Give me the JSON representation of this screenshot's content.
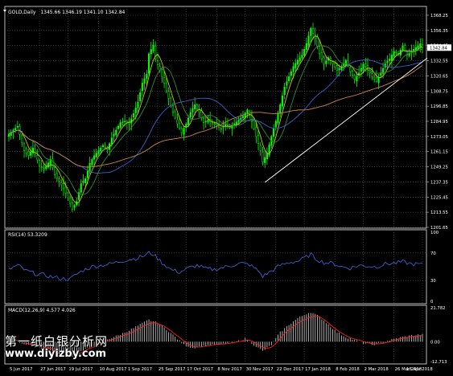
{
  "header": {
    "symbol": "GOLD,Daily",
    "values": "1345.66 1346.19 1341.10 1342.84"
  },
  "colors": {
    "bull": "#00ff00",
    "bear": "#000000",
    "grid": "#5a5a5a",
    "ma_fast": "#c8c800",
    "ma_mid": "#2e8b2e",
    "ma_slow": "#3a5fd0",
    "ma_long": "#cd853f",
    "trendline": "#ffffff",
    "rsi": "#4169e1",
    "macd_hist": "#c0c0c0",
    "macd_signal": "#ff2020",
    "price_box_bg": "#ffffff",
    "price_box_fg": "#000000"
  },
  "chart_data": [
    {
      "type": "candlestick",
      "title": "GOLD,Daily",
      "price_axis_ticks": [
        "1368.25",
        "1356.35",
        "1344.45",
        "1332.55",
        "1320.65",
        "1308.75",
        "1296.85",
        "1284.95",
        "1273.05",
        "1261.15",
        "1249.25",
        "1237.35",
        "1225.45",
        "1213.55",
        "1201.65"
      ],
      "ylim": [
        1201.65,
        1368.25
      ],
      "current_price": "1342.84",
      "date_ticks": [
        "5 Jun 2017",
        "27 Jun 2017",
        "19 Jul 2017",
        "10 Aug 2017",
        "1 Sep 2017",
        "25 Sep 2017",
        "17 Oct 2017",
        "8 Nov 2017",
        "30 Nov 2017",
        "22 Dec 2017",
        "17 Jan 2018",
        "8 Feb 2018",
        "2 Mar 2018",
        "26 Mar 2018",
        "18 Apr 2018"
      ],
      "close_anchors": [
        [
          0,
          1275
        ],
        [
          4,
          1281
        ],
        [
          7,
          1262
        ],
        [
          9,
          1258
        ],
        [
          11,
          1264
        ],
        [
          14,
          1250
        ],
        [
          16,
          1247
        ],
        [
          19,
          1255
        ],
        [
          21,
          1243
        ],
        [
          23,
          1238
        ],
        [
          25,
          1232
        ],
        [
          27,
          1225
        ],
        [
          29,
          1216
        ],
        [
          31,
          1222
        ],
        [
          33,
          1236
        ],
        [
          35,
          1240
        ],
        [
          37,
          1252
        ],
        [
          39,
          1258
        ],
        [
          41,
          1262
        ],
        [
          43,
          1266
        ],
        [
          45,
          1263
        ],
        [
          47,
          1272
        ],
        [
          49,
          1278
        ],
        [
          51,
          1284
        ],
        [
          53,
          1285
        ],
        [
          55,
          1283
        ],
        [
          57,
          1291
        ],
        [
          59,
          1300
        ],
        [
          61,
          1315
        ],
        [
          63,
          1322
        ],
        [
          64,
          1338
        ],
        [
          66,
          1345
        ],
        [
          67,
          1334
        ],
        [
          69,
          1325
        ],
        [
          71,
          1315
        ],
        [
          73,
          1303
        ],
        [
          75,
          1292
        ],
        [
          77,
          1283
        ],
        [
          79,
          1276
        ],
        [
          81,
          1283
        ],
        [
          83,
          1292
        ],
        [
          85,
          1298
        ],
        [
          87,
          1292
        ],
        [
          89,
          1284
        ],
        [
          91,
          1286
        ],
        [
          93,
          1283
        ],
        [
          95,
          1282
        ],
        [
          97,
          1279
        ],
        [
          99,
          1283
        ],
        [
          101,
          1280
        ],
        [
          103,
          1283
        ],
        [
          105,
          1286
        ],
        [
          107,
          1289
        ],
        [
          109,
          1294
        ],
        [
          111,
          1285
        ],
        [
          113,
          1273
        ],
        [
          115,
          1262
        ],
        [
          116,
          1253
        ],
        [
          118,
          1260
        ],
        [
          120,
          1273
        ],
        [
          122,
          1285
        ],
        [
          124,
          1298
        ],
        [
          126,
          1312
        ],
        [
          128,
          1320
        ],
        [
          130,
          1328
        ],
        [
          132,
          1333
        ],
        [
          134,
          1337
        ],
        [
          136,
          1346
        ],
        [
          138,
          1358
        ],
        [
          140,
          1350
        ],
        [
          142,
          1338
        ],
        [
          144,
          1330
        ],
        [
          146,
          1335
        ],
        [
          148,
          1330
        ],
        [
          150,
          1325
        ],
        [
          152,
          1328
        ],
        [
          154,
          1333
        ],
        [
          156,
          1324
        ],
        [
          158,
          1318
        ],
        [
          160,
          1323
        ],
        [
          162,
          1330
        ],
        [
          164,
          1326
        ],
        [
          166,
          1320
        ],
        [
          168,
          1316
        ],
        [
          170,
          1323
        ],
        [
          172,
          1330
        ],
        [
          174,
          1334
        ],
        [
          176,
          1340
        ],
        [
          178,
          1338
        ],
        [
          180,
          1344
        ],
        [
          182,
          1337
        ],
        [
          184,
          1340
        ],
        [
          186,
          1343
        ],
        [
          188,
          1346
        ],
        [
          189,
          1342.84
        ]
      ],
      "moving_averages": [
        {
          "period": "fast",
          "smoothing": 5
        },
        {
          "period": "mid",
          "smoothing": 11
        },
        {
          "period": "slow",
          "smoothing": 34
        },
        {
          "period": "long",
          "smoothing": 70
        }
      ],
      "trendline": {
        "from": [
          117,
          1237
        ],
        "to": [
          189,
          1334
        ]
      }
    },
    {
      "type": "line",
      "title": "RSI(14) 53.3209",
      "ticks": [
        "100",
        "70",
        "30",
        "0"
      ],
      "ylim": [
        0,
        100
      ],
      "levels": [
        70,
        30
      ],
      "anchors": [
        [
          0,
          46
        ],
        [
          4,
          52
        ],
        [
          8,
          44
        ],
        [
          12,
          40
        ],
        [
          16,
          38
        ],
        [
          20,
          35
        ],
        [
          24,
          33
        ],
        [
          28,
          32
        ],
        [
          30,
          37
        ],
        [
          34,
          45
        ],
        [
          38,
          50
        ],
        [
          42,
          52
        ],
        [
          46,
          54
        ],
        [
          50,
          57
        ],
        [
          54,
          60
        ],
        [
          58,
          62
        ],
        [
          62,
          66
        ],
        [
          64,
          70
        ],
        [
          66,
          68
        ],
        [
          70,
          56
        ],
        [
          74,
          46
        ],
        [
          78,
          42
        ],
        [
          82,
          48
        ],
        [
          86,
          52
        ],
        [
          90,
          47
        ],
        [
          94,
          46
        ],
        [
          98,
          49
        ],
        [
          102,
          52
        ],
        [
          106,
          55
        ],
        [
          110,
          53
        ],
        [
          114,
          44
        ],
        [
          116,
          36
        ],
        [
          120,
          44
        ],
        [
          124,
          52
        ],
        [
          128,
          56
        ],
        [
          132,
          58
        ],
        [
          136,
          64
        ],
        [
          138,
          68
        ],
        [
          140,
          62
        ],
        [
          144,
          56
        ],
        [
          148,
          55
        ],
        [
          152,
          50
        ],
        [
          156,
          48
        ],
        [
          160,
          52
        ],
        [
          164,
          51
        ],
        [
          168,
          50
        ],
        [
          172,
          54
        ],
        [
          176,
          55
        ],
        [
          180,
          57
        ],
        [
          184,
          54
        ],
        [
          189,
          53.3
        ]
      ]
    },
    {
      "type": "histogram",
      "title": "MACD(12,26,9) 4.577 4.026",
      "ticks": [
        "21.782",
        "0.00",
        "-12.713"
      ],
      "ylim": [
        -12.713,
        21.782
      ],
      "zero_line": 0,
      "hist_anchors": [
        [
          0,
          2
        ],
        [
          6,
          -1
        ],
        [
          12,
          -3
        ],
        [
          18,
          -5
        ],
        [
          24,
          -8
        ],
        [
          28,
          -10
        ],
        [
          32,
          -7
        ],
        [
          38,
          -3
        ],
        [
          44,
          1
        ],
        [
          50,
          4
        ],
        [
          56,
          8
        ],
        [
          60,
          11
        ],
        [
          64,
          14
        ],
        [
          68,
          12
        ],
        [
          72,
          8
        ],
        [
          76,
          3
        ],
        [
          80,
          -2
        ],
        [
          84,
          -4
        ],
        [
          88,
          -3
        ],
        [
          92,
          -2
        ],
        [
          96,
          -2
        ],
        [
          100,
          -1
        ],
        [
          104,
          0
        ],
        [
          108,
          2
        ],
        [
          112,
          -2
        ],
        [
          116,
          -6
        ],
        [
          120,
          -2
        ],
        [
          124,
          6
        ],
        [
          128,
          11
        ],
        [
          132,
          15
        ],
        [
          136,
          18
        ],
        [
          138,
          19
        ],
        [
          142,
          16
        ],
        [
          146,
          11
        ],
        [
          150,
          6
        ],
        [
          154,
          3
        ],
        [
          158,
          1
        ],
        [
          162,
          -1
        ],
        [
          166,
          -2
        ],
        [
          170,
          -1
        ],
        [
          174,
          1
        ],
        [
          180,
          3
        ],
        [
          184,
          4
        ],
        [
          189,
          4.577
        ]
      ],
      "signal_smoothing": 5
    }
  ],
  "watermark": {
    "line1": "第一纸白银分析网",
    "line2": "www.diyizby.com"
  }
}
